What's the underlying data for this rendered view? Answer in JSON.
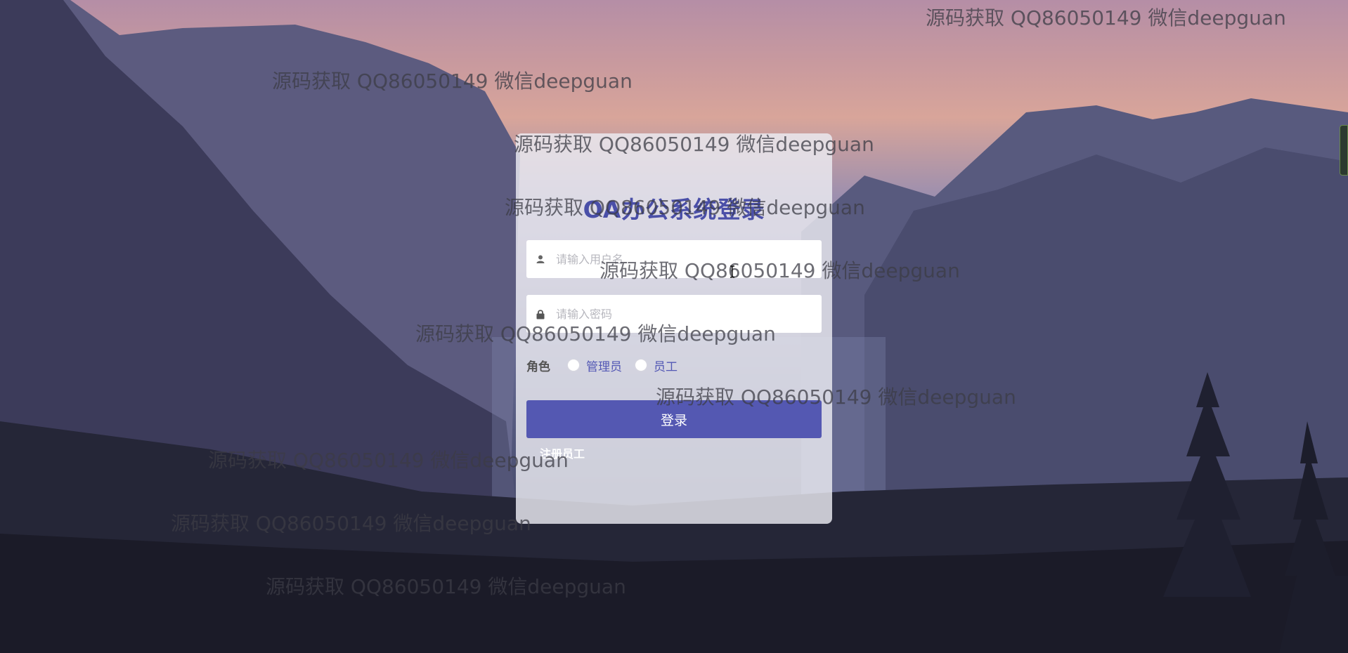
{
  "login": {
    "title": "OA办公系统登录",
    "username_placeholder": "请输入用户名",
    "password_placeholder": "请输入密码",
    "role_label": "角色",
    "roles": [
      "管理员",
      "员工"
    ],
    "submit_label": "登录",
    "register_link": "注册员工"
  },
  "icons": {
    "username": "user-icon",
    "password": "lock-icon"
  },
  "colors": {
    "accent": "#5458b2",
    "title": "#4a4fa8"
  },
  "watermarks": [
    "源码获取 QQ86050149 微信deepguan",
    "源码获取 QQ86050149 微信deepguan",
    "源码获取 QQ86050149 微信deepguan",
    "源码获取 QQ86050149 微信deepguan",
    "源码获取 QQ86050149 微信deepguan",
    "源码获取 QQ86050149 微信deepguan",
    "源码获取 QQ86050149 微信deepguan",
    "源码获取 QQ86050149 微信deepguan",
    "源码获取 QQ86050149 微信deepguan",
    "源码获取 QQ86050149 微信deepguan"
  ]
}
